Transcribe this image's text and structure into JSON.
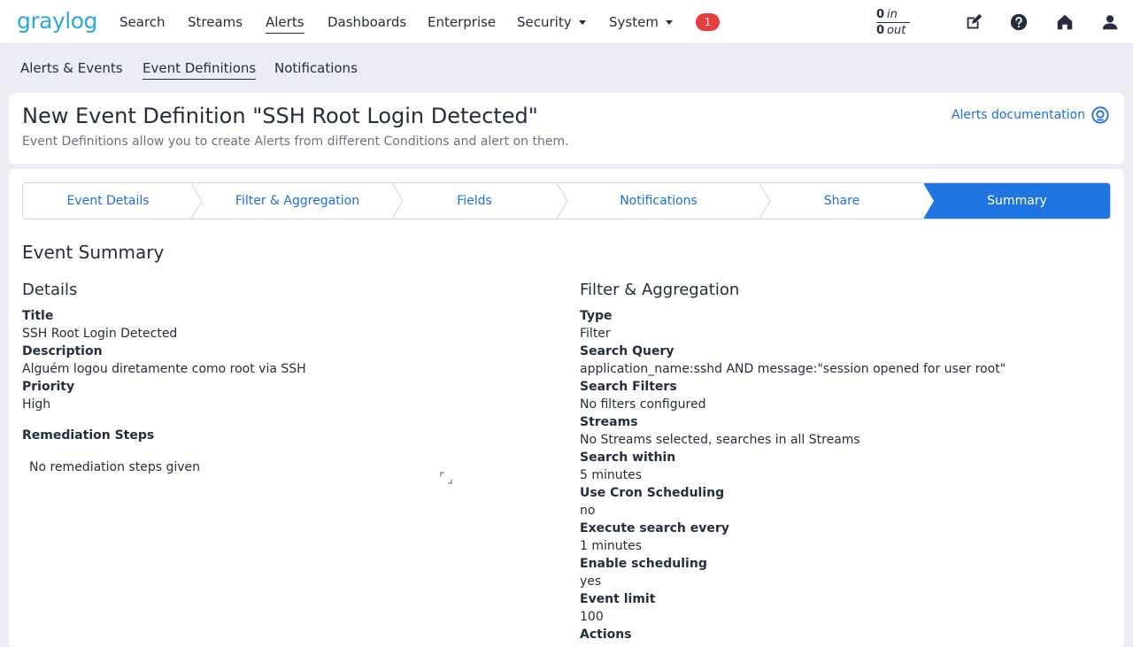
{
  "nav": {
    "logo": "graylog",
    "items": [
      "Search",
      "Streams",
      "Alerts",
      "Dashboards",
      "Enterprise",
      "Security",
      "System"
    ],
    "badge": "1",
    "throughput": {
      "in_value": "0",
      "in_label": "in",
      "out_value": "0",
      "out_label": "out"
    }
  },
  "subnav": {
    "items": [
      "Alerts & Events",
      "Event Definitions",
      "Notifications"
    ]
  },
  "header": {
    "title": "New Event Definition \"SSH Root Login Detected\"",
    "subtitle": "Event Definitions allow you to create Alerts from different Conditions and alert on them.",
    "doc_link": "Alerts documentation"
  },
  "steps": [
    "Event Details",
    "Filter & Aggregation",
    "Fields",
    "Notifications",
    "Share",
    "Summary"
  ],
  "summary": {
    "title": "Event Summary",
    "details": {
      "heading": "Details",
      "title_label": "Title",
      "title_value": "SSH Root Login Detected",
      "description_label": "Description",
      "description_value": "Alguém logou diretamente como root via SSH",
      "priority_label": "Priority",
      "priority_value": "High",
      "remediation_label": "Remediation Steps",
      "remediation_value": "No remediation steps given"
    },
    "filter": {
      "heading": "Filter & Aggregation",
      "fields": [
        {
          "label": "Type",
          "value": "Filter"
        },
        {
          "label": "Search Query",
          "value": "application_name:sshd AND message:\"session opened for user root\""
        },
        {
          "label": "Search Filters",
          "value": "No filters configured"
        },
        {
          "label": "Streams",
          "value": "No Streams selected, searches in all Streams"
        },
        {
          "label": "Search within",
          "value": "5 minutes"
        },
        {
          "label": "Use Cron Scheduling",
          "value": "no"
        },
        {
          "label": "Execute search every",
          "value": "1 minutes"
        },
        {
          "label": "Enable scheduling",
          "value": "yes"
        },
        {
          "label": "Event limit",
          "value": "100"
        },
        {
          "label": "Actions",
          "value": ""
        }
      ]
    }
  },
  "colors": {
    "accent": "#1f75e0",
    "link": "#1f6fd6",
    "badge": "#e53e3e",
    "logo": "#2fa6d8"
  }
}
